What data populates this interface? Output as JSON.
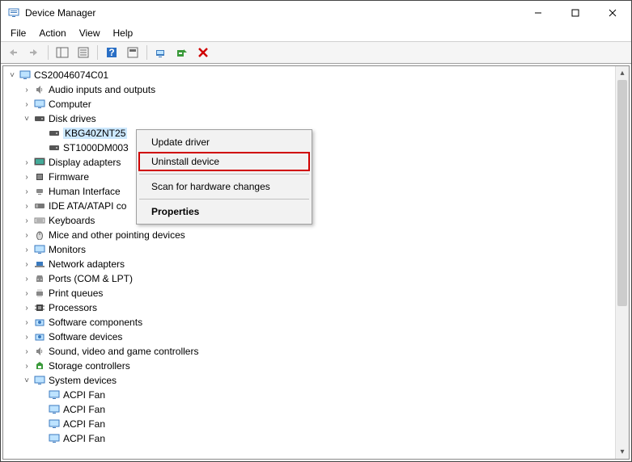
{
  "window": {
    "title": "Device Manager"
  },
  "menubar": {
    "file": "File",
    "action": "Action",
    "view": "View",
    "help": "Help"
  },
  "tree": {
    "root": "CS20046074C01",
    "audio": "Audio inputs and outputs",
    "computer": "Computer",
    "disk_drives": "Disk drives",
    "disk0": "KBG40ZNT25",
    "disk1": "ST1000DM003",
    "display_adapters": "Display adapters",
    "firmware": "Firmware",
    "hid": "Human Interface",
    "ide": "IDE ATA/ATAPI co",
    "keyboards": "Keyboards",
    "mice": "Mice and other pointing devices",
    "monitors": "Monitors",
    "network": "Network adapters",
    "ports": "Ports (COM & LPT)",
    "print_queues": "Print queues",
    "processors": "Processors",
    "sw_components": "Software components",
    "sw_devices": "Software devices",
    "sound": "Sound, video and game controllers",
    "storage": "Storage controllers",
    "system_devices": "System devices",
    "acpi_fan0": "ACPI Fan",
    "acpi_fan1": "ACPI Fan",
    "acpi_fan2": "ACPI Fan",
    "acpi_fan3": "ACPI Fan"
  },
  "context_menu": {
    "update": "Update driver",
    "uninstall": "Uninstall device",
    "scan": "Scan for hardware changes",
    "properties": "Properties"
  }
}
